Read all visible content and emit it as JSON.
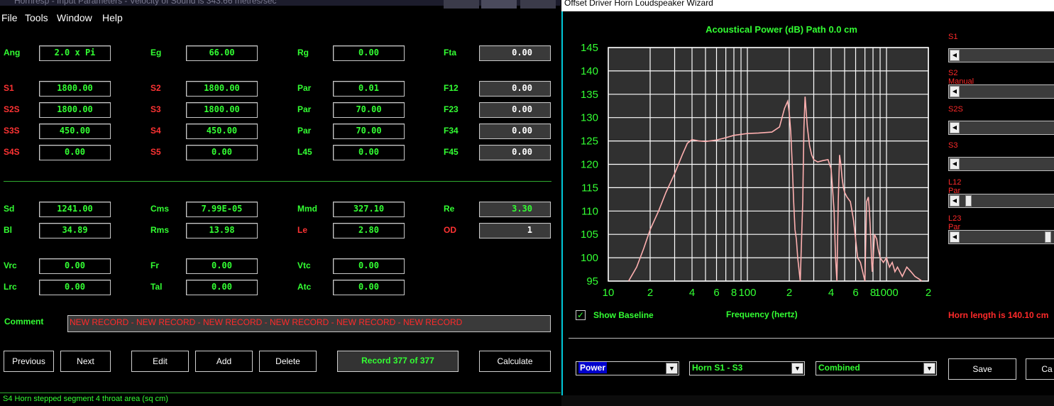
{
  "left": {
    "title": "Hornresp - Input Parameters - Velocity of Sound is 343.66 metres/sec",
    "menu": [
      "File",
      "Tools",
      "Window",
      "Help"
    ],
    "rows": [
      [
        {
          "label": "Ang",
          "c": "g",
          "value": "2.0 x Pi"
        },
        {
          "label": "Eg",
          "c": "g",
          "value": "66.00"
        },
        {
          "label": "Rg",
          "c": "g",
          "value": "0.00"
        },
        {
          "label": "Fta",
          "c": "g",
          "value": "0.00",
          "grey": true
        }
      ],
      [
        {
          "label": "S1",
          "c": "r",
          "value": "1800.00"
        },
        {
          "label": "S2",
          "c": "r",
          "value": "1800.00"
        },
        {
          "label": "Par",
          "c": "g",
          "value": "0.01"
        },
        {
          "label": "F12",
          "c": "g",
          "value": "0.00",
          "grey": true
        }
      ],
      [
        {
          "label": "S2S",
          "c": "r",
          "value": "1800.00"
        },
        {
          "label": "S3",
          "c": "r",
          "value": "1800.00"
        },
        {
          "label": "Par",
          "c": "g",
          "value": "70.00"
        },
        {
          "label": "F23",
          "c": "g",
          "value": "0.00",
          "grey": true
        }
      ],
      [
        {
          "label": "S3S",
          "c": "r",
          "value": "450.00"
        },
        {
          "label": "S4",
          "c": "r",
          "value": "450.00"
        },
        {
          "label": "Par",
          "c": "g",
          "value": "70.00"
        },
        {
          "label": "F34",
          "c": "g",
          "value": "0.00",
          "grey": true
        }
      ],
      [
        {
          "label": "S4S",
          "c": "r",
          "value": "0.00"
        },
        {
          "label": "S5",
          "c": "r",
          "value": "0.00"
        },
        {
          "label": "L45",
          "c": "g",
          "value": "0.00"
        },
        {
          "label": "F45",
          "c": "g",
          "value": "0.00",
          "grey": true
        }
      ],
      [
        {
          "label": "Sd",
          "c": "g",
          "value": "1241.00"
        },
        {
          "label": "Cms",
          "c": "g",
          "value": "7.99E-05"
        },
        {
          "label": "Mmd",
          "c": "g",
          "value": "327.10"
        },
        {
          "label": "Re",
          "c": "g",
          "value": "3.30",
          "grey": true,
          "green": true
        }
      ],
      [
        {
          "label": "Bl",
          "c": "g",
          "value": "34.89"
        },
        {
          "label": "Rms",
          "c": "g",
          "value": "13.98"
        },
        {
          "label": "Le",
          "c": "r",
          "value": "2.80"
        },
        {
          "label": "OD",
          "c": "r",
          "value": "1",
          "grey": true,
          "white": true
        }
      ],
      [
        {
          "label": "Vrc",
          "c": "g",
          "value": "0.00"
        },
        {
          "label": "Fr",
          "c": "g",
          "value": "0.00"
        },
        {
          "label": "Vtc",
          "c": "g",
          "value": "0.00"
        }
      ],
      [
        {
          "label": "Lrc",
          "c": "g",
          "value": "0.00"
        },
        {
          "label": "Tal",
          "c": "g",
          "value": "0.00"
        },
        {
          "label": "Atc",
          "c": "g",
          "value": "0.00"
        }
      ]
    ],
    "comment_label": "Comment",
    "comment_value": "NEW RECORD - NEW RECORD - NEW RECORD - NEW RECORD - NEW RECORD - NEW RECORD",
    "buttons": {
      "previous": "Previous",
      "next": "Next",
      "edit": "Edit",
      "add": "Add",
      "delete": "Delete",
      "record": "Record 377 of 377",
      "calculate": "Calculate"
    },
    "status": "S4   Horn stepped segment 4 throat area  (sq cm)"
  },
  "right": {
    "title": "Offset Driver Horn Loudspeaker Wizard",
    "chart_title": "Acoustical Power (dB)   Path 0.0 cm",
    "show_baseline": "Show Baseline",
    "horn_length": "Horn length is 140.10 cm",
    "sliders": [
      {
        "label": "S1",
        "pos": 0.0
      },
      {
        "label": "S2 Manual",
        "pos": 0.0
      },
      {
        "label": "S2S",
        "pos": 0.0
      },
      {
        "label": "S3",
        "pos": 0.0
      },
      {
        "label": "L12 Par",
        "pos": 0.05
      },
      {
        "label": "L23 Par",
        "pos": 0.85
      }
    ],
    "combos": {
      "type": "Power",
      "path": "Horn S1 - S3",
      "mode": "Combined"
    },
    "buttons": {
      "save": "Save",
      "cancel": "Ca"
    },
    "colors": {
      "curve": "#ffb0b0",
      "grid": "#ffffff",
      "plot_bg": "#303030",
      "axis_text": "#33ff33"
    }
  },
  "chart_data": {
    "type": "line",
    "title": "Acoustical Power (dB)   Path 0.0 cm",
    "xlabel": "Frequency (hertz)",
    "ylabel": "",
    "x_scale": "log",
    "xlim": [
      10,
      2000
    ],
    "ylim": [
      95,
      145
    ],
    "x_ticks": [
      "10",
      "2",
      "4",
      "6",
      "8",
      "100",
      "2",
      "4",
      "6",
      "8",
      "1000",
      "2"
    ],
    "y_ticks": [
      "145",
      "140",
      "135",
      "130",
      "125",
      "120",
      "115",
      "110",
      "105",
      "100",
      "95"
    ],
    "grid": true,
    "series": [
      {
        "x": [
          14,
          16,
          18,
          20,
          23,
          26,
          30,
          34,
          37,
          40,
          45,
          50,
          60,
          70,
          80,
          100,
          120,
          150,
          170,
          185,
          195,
          200,
          205,
          210,
          215,
          220,
          225,
          230,
          240,
          250,
          255,
          260,
          270,
          280,
          285,
          290,
          300,
          320,
          350,
          380,
          400,
          420,
          430,
          440,
          450,
          460,
          470,
          480,
          490,
          500,
          520,
          550,
          580,
          600,
          620,
          650,
          700,
          720,
          740,
          750,
          760,
          770,
          780,
          790,
          800,
          820,
          850,
          870,
          900,
          950,
          1000,
          1050,
          1100,
          1150,
          1200,
          1300,
          1400,
          1500,
          1600,
          1700,
          1800
        ],
        "values": [
          95,
          98,
          102,
          106,
          110,
          114,
          118,
          122,
          124.5,
          125.3,
          125.0,
          124.9,
          125.2,
          125.7,
          126.2,
          126.6,
          126.7,
          126.9,
          128,
          132,
          133.5,
          131,
          127,
          120,
          112,
          106,
          104,
          100,
          95,
          112,
          128,
          134.5,
          128,
          124,
          123,
          122,
          121,
          120.5,
          120.8,
          121,
          119,
          110,
          100,
          95,
          112,
          122,
          120,
          117,
          115,
          114,
          113,
          112,
          108,
          104,
          100,
          99,
          95,
          112,
          113,
          111,
          108,
          104,
          100,
          97,
          99,
          105,
          104,
          102,
          100,
          99,
          100,
          98,
          99,
          97,
          98,
          96,
          98,
          97,
          96,
          95.5,
          95
        ]
      }
    ]
  }
}
